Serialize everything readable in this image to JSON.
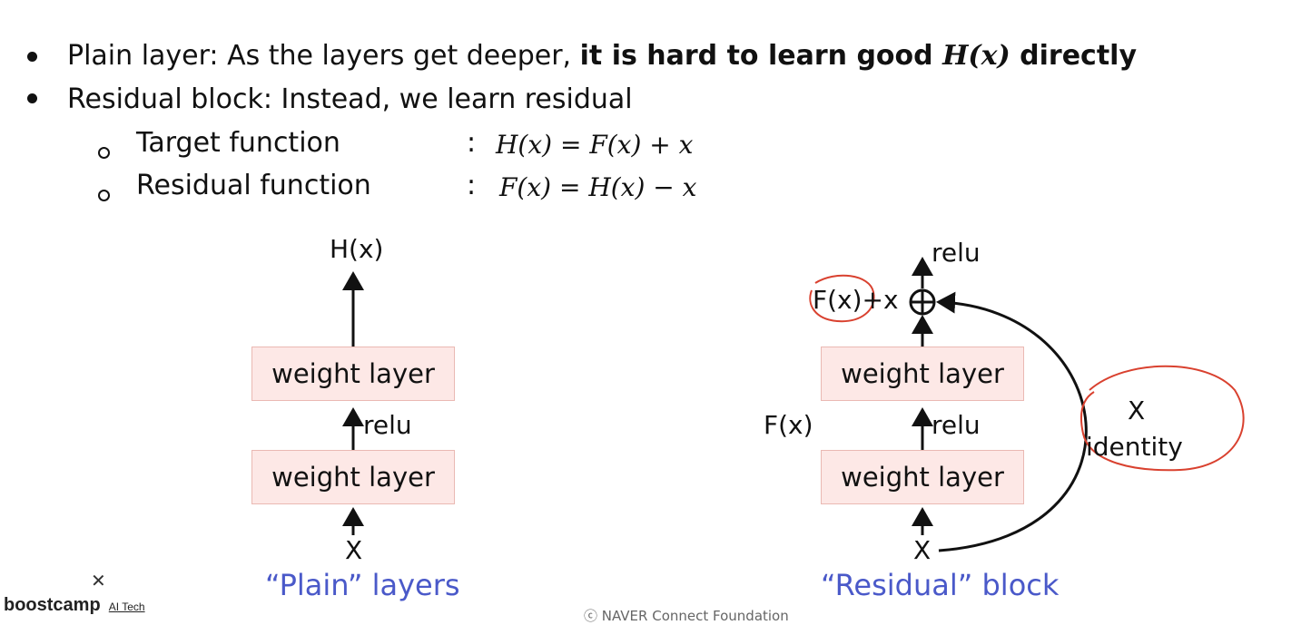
{
  "bullets": [
    {
      "plain": "Plain layer: As the layers get deeper, ",
      "bold": "it is hard to learn good ",
      "bold_math": "H(x)",
      "bold_tail": " directly"
    },
    {
      "plain": "Residual block: Instead, we learn residual"
    }
  ],
  "sub_bullets": [
    {
      "label": "Target function",
      "colon": ":",
      "formula": "H(x) = F(x) + x"
    },
    {
      "label": "Residual function",
      "colon": ":",
      "formula": "F(x) = H(x) − x"
    }
  ],
  "plain_diagram": {
    "output": "H(x)",
    "top_layer": "weight layer",
    "activation": "relu",
    "bottom_layer": "weight layer",
    "input": "X",
    "caption": "“Plain” layers"
  },
  "residual_diagram": {
    "output_activation": "relu",
    "sum_label": "F(x)+x",
    "top_layer": "weight layer",
    "activation": "relu",
    "bottom_layer": "weight layer",
    "branch_label": "F(x)",
    "input": "X",
    "skip_symbol": "X",
    "skip_label": "identity",
    "caption": "“Residual” block"
  },
  "branding": {
    "mark": "✕",
    "name": "boostcamp",
    "suffix": "AI Tech"
  },
  "footer": "ⓒ  NAVER Connect Foundation",
  "colors": {
    "caption": "#4a59c9",
    "layer_fill": "#fde8e6",
    "annotation": "#d9412f"
  }
}
